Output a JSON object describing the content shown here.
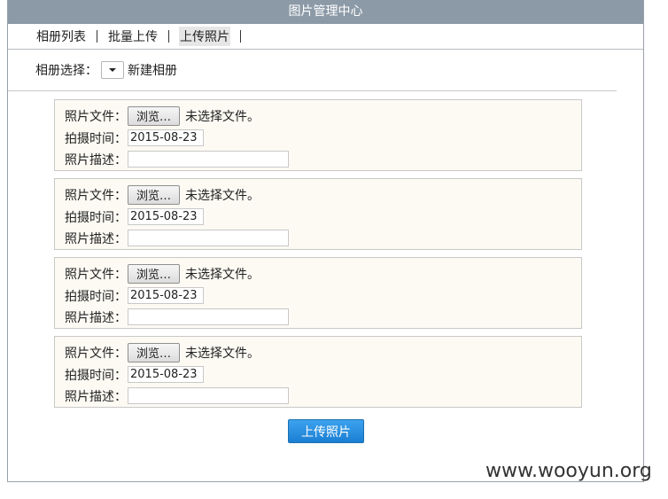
{
  "window": {
    "title": "图片管理中心"
  },
  "tabs": [
    {
      "label": "相册列表",
      "active": false
    },
    {
      "label": "批量上传",
      "active": false
    },
    {
      "label": "上传照片",
      "active": true
    }
  ],
  "album": {
    "label": "相册选择：",
    "selected": "",
    "new_album_link": "新建相册"
  },
  "upload_items": [
    {
      "file_label": "照片文件：",
      "browse_label": "浏览…",
      "file_status": "未选择文件。",
      "date_label": "拍摄时间：",
      "date_value": "2015-08-23",
      "desc_label": "照片描述：",
      "desc_value": ""
    },
    {
      "file_label": "照片文件：",
      "browse_label": "浏览…",
      "file_status": "未选择文件。",
      "date_label": "拍摄时间：",
      "date_value": "2015-08-23",
      "desc_label": "照片描述：",
      "desc_value": ""
    },
    {
      "file_label": "照片文件：",
      "browse_label": "浏览…",
      "file_status": "未选择文件。",
      "date_label": "拍摄时间：",
      "date_value": "2015-08-23",
      "desc_label": "照片描述：",
      "desc_value": ""
    },
    {
      "file_label": "照片文件：",
      "browse_label": "浏览…",
      "file_status": "未选择文件。",
      "date_label": "拍摄时间：",
      "date_value": "2015-08-23",
      "desc_label": "照片描述：",
      "desc_value": ""
    }
  ],
  "submit_label": "上传照片",
  "watermark": "www.wooyun.org",
  "colors": {
    "titlebar": "#8c9aa7",
    "box_bg": "#fcfaf3",
    "submit": "#2a8fe0"
  }
}
